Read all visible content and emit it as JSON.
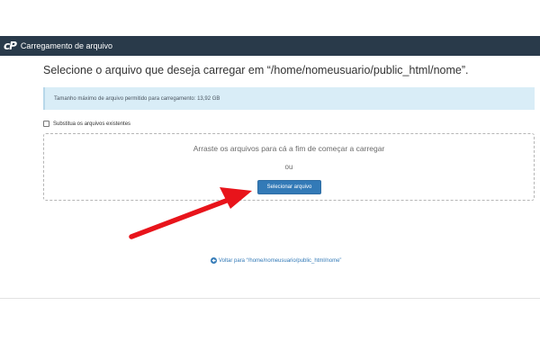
{
  "header": {
    "logo_text": "cP",
    "title": "Carregamento de arquivo"
  },
  "main": {
    "heading": "Selecione o arquivo que deseja carregar em “/home/nomeusuario/public_html/nome”.",
    "max_size_info": "Tamanho máximo de arquivo permitido para carregamento: 13,92 GB",
    "overwrite_label": "Substitua os arquivos existentes",
    "overwrite_checked": false,
    "dropzone_text": "Arraste os arquivos para cá a fim de começar a carregar",
    "or_text": "ou",
    "select_button_label": "Selecionar arquivo",
    "back_link": "Voltar para “/home/nomeusuario/public_html/nome”"
  },
  "colors": {
    "header_bg": "#293a4a",
    "info_bg": "#d9edf7",
    "button_bg": "#337ab7",
    "link": "#337ab7",
    "annotation_arrow": "#e8141b"
  },
  "icons": {
    "logo": "cpanel-logo-icon",
    "back": "circle-arrow-left-icon",
    "annotation": "red-arrow-icon"
  }
}
